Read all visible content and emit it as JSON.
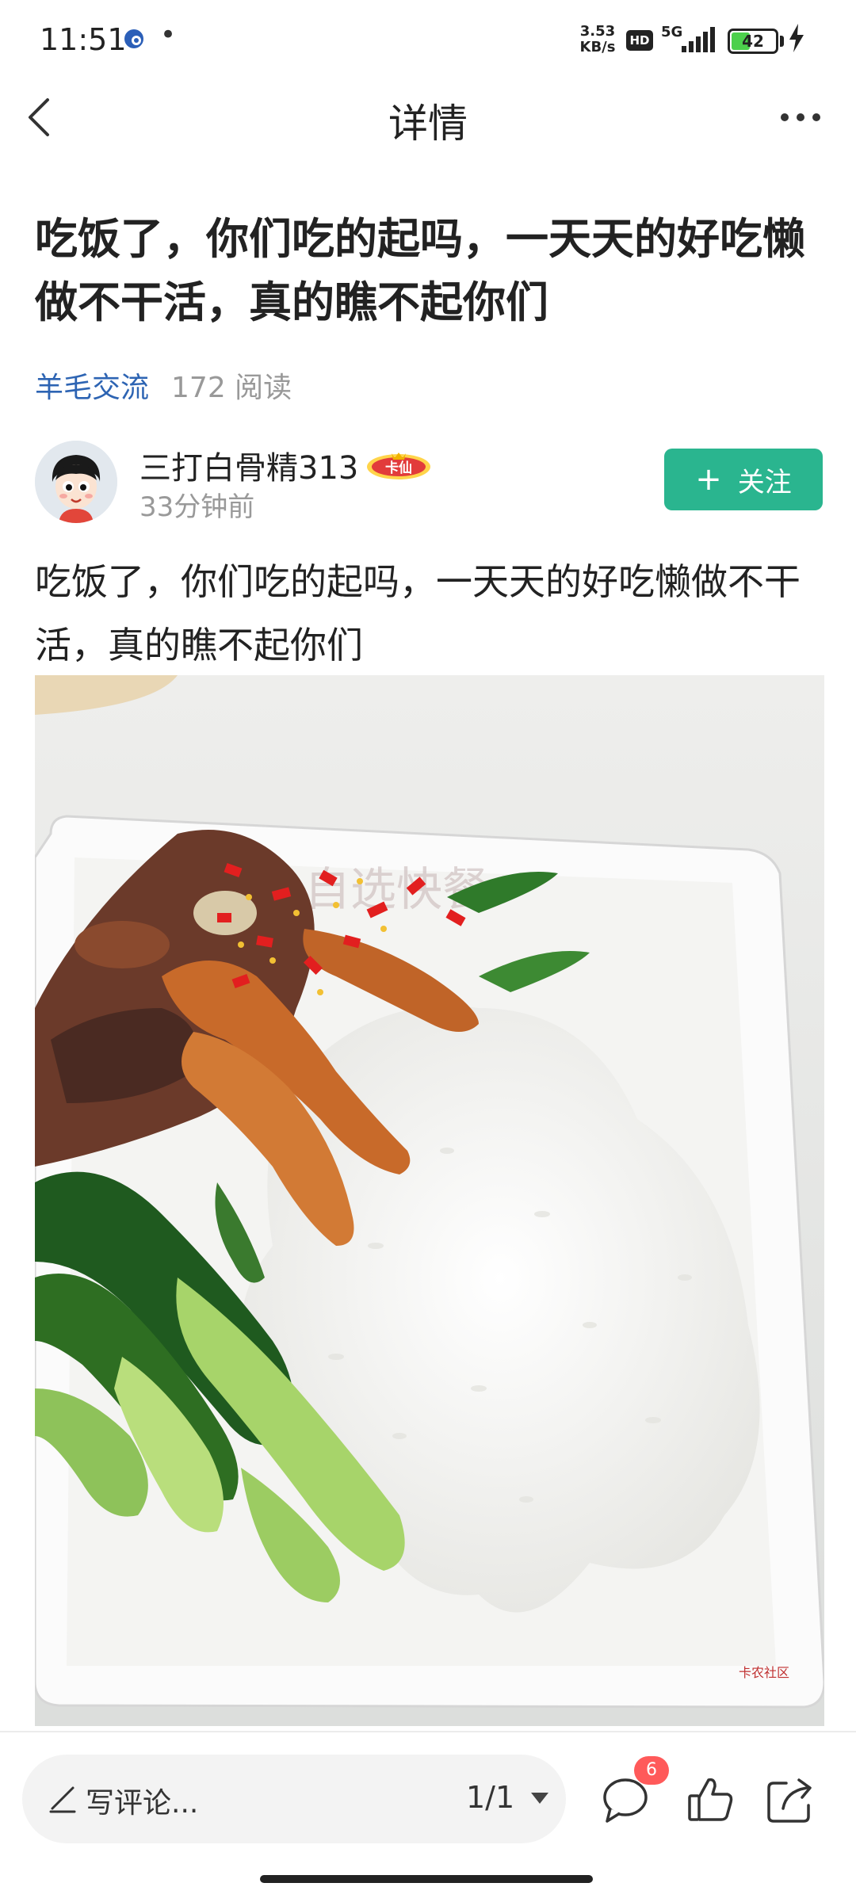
{
  "status_bar": {
    "time": "11:51",
    "dot": "•",
    "net_speed_value": "3.53",
    "net_speed_unit": "KB/s",
    "hd": "HD",
    "net_type": "5G",
    "battery": "42",
    "battery_level": 0.42
  },
  "nav": {
    "title": "详情"
  },
  "post": {
    "title": "吃饭了，你们吃的起吗，一天天的好吃懒做不干活，真的瞧不起你们",
    "topic": "羊毛交流",
    "reads": "172 阅读",
    "body": "吃饭了，你们吃的起吗，一天天的好吃懒做不干活，真的瞧不起你们",
    "image_watermark_text": "自选快餐",
    "image_corner_mark": "卡农社区"
  },
  "author": {
    "name": "三打白骨精313",
    "badge": "卡仙",
    "time": "33分钟前",
    "follow_label": "关注"
  },
  "bottom": {
    "comment_placeholder": "写评论...",
    "page_indicator": "1/1",
    "comment_count": "6"
  },
  "colors": {
    "accent": "#2ab58f",
    "topic_link": "#2d64b3",
    "badge_red": "#ff5a5a"
  }
}
